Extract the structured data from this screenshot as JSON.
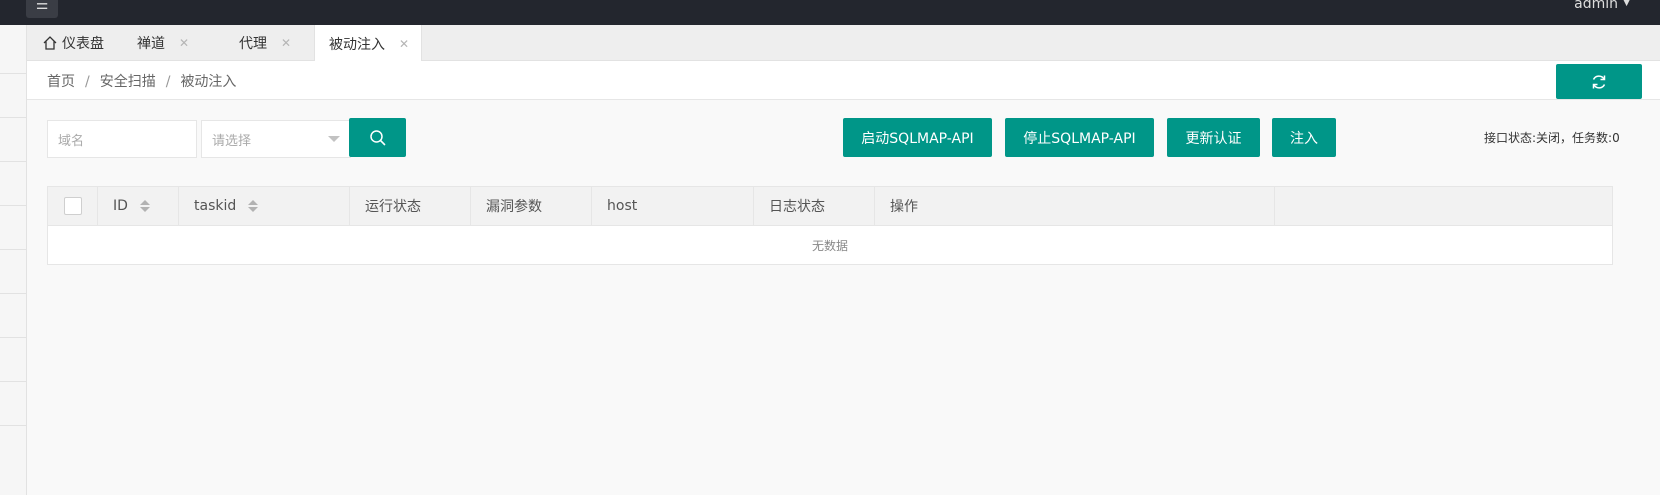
{
  "topbar": {
    "user": "admin"
  },
  "tabs": [
    {
      "label": "仪表盘",
      "icon": "home-icon"
    },
    {
      "label": "禅道"
    },
    {
      "label": "代理"
    },
    {
      "label": "被动注入"
    }
  ],
  "breadcrumb": [
    "首页",
    "安全扫描",
    "被动注入"
  ],
  "filters": {
    "domain_placeholder": "域名",
    "select_placeholder": "请选择"
  },
  "actions": {
    "start": "启动SQLMAP-API",
    "stop": "停止SQLMAP-API",
    "update": "更新认证",
    "inject": "注入"
  },
  "status": "接口状态:关闭，任务数:0",
  "table": {
    "columns": [
      "ID",
      "taskid",
      "运行状态",
      "漏洞参数",
      "host",
      "日志状态",
      "操作"
    ],
    "empty_text": "无数据"
  },
  "colors": {
    "primary": "#009688",
    "topbar": "#23262e"
  }
}
